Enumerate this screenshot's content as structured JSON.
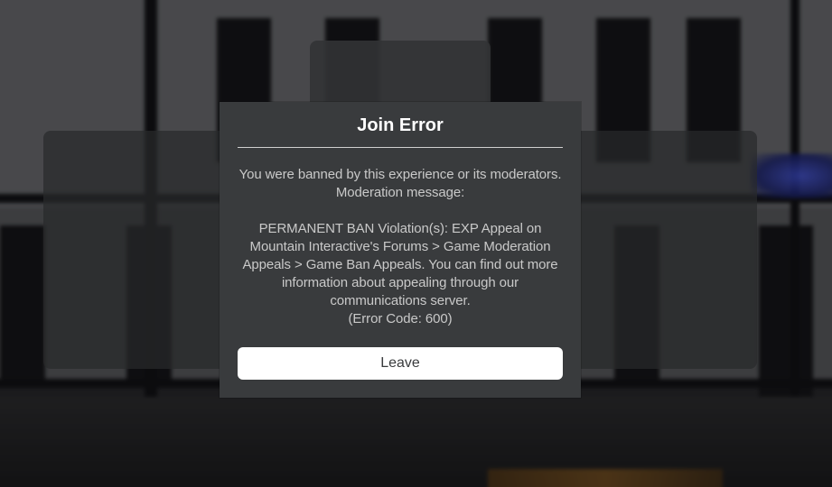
{
  "dialog": {
    "title": "Join Error",
    "message": "You were banned by this experience or its moderators. Moderation message:\n\nPERMANENT BAN Violation(s): EXP Appeal on Mountain Interactive's Forums > Game Moderation Appeals > Game Ban Appeals. You can find out more information about appealing through our communications server.\n(Error Code: 600)",
    "leave_label": "Leave"
  },
  "colors": {
    "dialog_background": "#393b3d",
    "title_text": "#ffffff",
    "message_text": "#c9c9c9",
    "button_background": "#ffffff",
    "button_text": "#393b3d"
  }
}
